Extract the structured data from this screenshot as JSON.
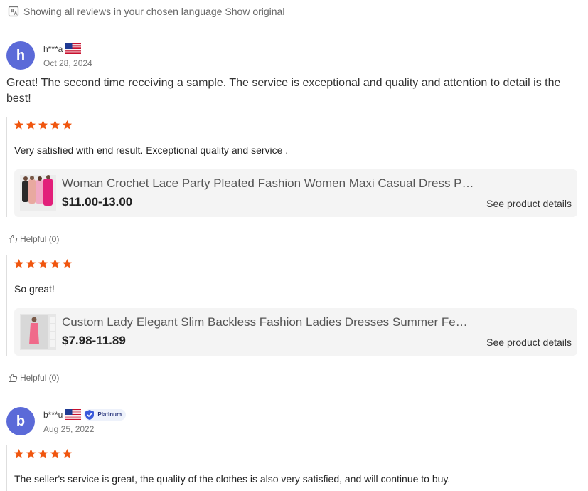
{
  "language_bar": {
    "icon": "translate-icon",
    "message": "Showing all reviews in your chosen language",
    "link": "Show original"
  },
  "reviews": [
    {
      "avatar_letter": "h",
      "username": "h***a",
      "country_flag": "us-flag-icon",
      "date": "Oct 28, 2024",
      "comment": "Great! The second time receiving a sample. The service is exceptional and quality and attention to detail is the best!",
      "items": [
        {
          "rating": 5,
          "text": "Very satisfied with end result. Exceptional quality and service .",
          "product": {
            "title": "Woman Crochet Lace Party Pleated Fashion Women Maxi Casual Dress Pl...",
            "price": "$11.00-13.00",
            "details_link": "See product details"
          },
          "helpful": "Helpful (0)"
        },
        {
          "rating": 5,
          "text": "So great!",
          "product": {
            "title": "Custom Lady Elegant Slim Backless Fashion Ladies Dresses Summer Femal...",
            "price": "$7.98-11.89",
            "details_link": "See product details"
          },
          "helpful": "Helpful (0)"
        }
      ]
    },
    {
      "avatar_letter": "b",
      "username": "b***u",
      "country_flag": "us-flag-icon",
      "badge": "Platinum",
      "date": "Aug 25, 2022",
      "items": [
        {
          "rating": 5,
          "text": "The seller's service is great, the quality of the clothes is also very satisfied, and will continue to buy."
        }
      ]
    }
  ],
  "colors": {
    "avatar": "#5b6ad8",
    "star": "#f0560f",
    "product_card_bg": "#f4f4f4"
  }
}
